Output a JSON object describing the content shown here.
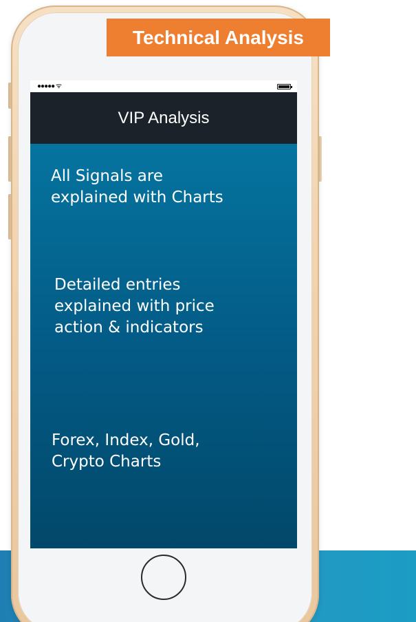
{
  "badge": {
    "label": "Technical Analysis",
    "color": "#ee7f31"
  },
  "status_bar": {
    "signal": "●●●●● ᯤ",
    "battery_icon": "battery-icon"
  },
  "nav": {
    "title": "VIP Analysis"
  },
  "features": [
    {
      "text": "All Signals are explained with Charts",
      "lines": [
        "All Signals are",
        "explained with Charts"
      ]
    },
    {
      "text": "Detailed entries explained with price action & indicators",
      "lines": [
        "Detailed entries",
        "explained with price",
        "action & indicators"
      ]
    },
    {
      "text": "Forex, Index, Gold, Crypto Charts",
      "lines": [
        "Forex, Index, Gold,",
        "Crypto Charts"
      ]
    }
  ],
  "colors": {
    "nav_background": "#1b222a",
    "content_top": "#05749f",
    "content_bottom": "#02486a",
    "bottom_band": "#1f7fb4",
    "phone_frame": "#f1d4b0"
  }
}
